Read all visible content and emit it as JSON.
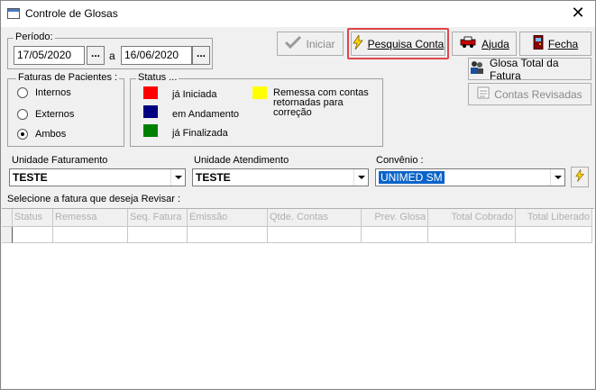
{
  "window": {
    "title": "Controle de Glosas",
    "close_glyph": "✕"
  },
  "periodo": {
    "label": "Período:",
    "start_date": "17/05/2020",
    "separator": "a",
    "end_date": "16/06/2020",
    "picker_label": "..."
  },
  "faturas": {
    "label": "Faturas de Pacientes :",
    "options": [
      "Internos",
      "Externos",
      "Ambos"
    ],
    "selected": "Ambos"
  },
  "status": {
    "label": "Status ...",
    "items": [
      {
        "label": "já Iniciada",
        "color": "#ff0000"
      },
      {
        "label": "em Andamento",
        "color": "#000080"
      },
      {
        "label": "já Finalizada",
        "color": "#008000"
      }
    ],
    "retornadas": {
      "label": "Remessa com contas retornadas para correção",
      "color": "#ffff00"
    }
  },
  "toolbar": {
    "iniciar": "Iniciar",
    "pesquisa": "Pesquisa Conta",
    "ajuda": "Ajuda",
    "fecha": "Fecha",
    "glosa_total": "Glosa Total da Fatura",
    "contas_revisadas": "Contas Revisadas"
  },
  "filters": {
    "unidade_faturamento": {
      "label": "Unidade Faturamento",
      "value": "TESTE"
    },
    "unidade_atendimento": {
      "label": "Unidade Atendimento",
      "value": "TESTE"
    },
    "convenio": {
      "label": "Convênio :",
      "value": "UNIMED SM"
    }
  },
  "grid": {
    "prompt": "Selecione a fatura que deseja Revisar :",
    "columns": [
      "Status",
      "Remessa",
      "Seq. Fatura",
      "Emissão",
      "Qtde. Contas",
      "Prev. Glosa",
      "Total Cobrado",
      "Total Liberado"
    ]
  },
  "icons": {
    "app": "window-icon",
    "iniciar": "checkmark-icon",
    "pesquisa": "lightning-icon",
    "ajuda": "help-car-icon",
    "fecha": "door-exit-icon",
    "glosa_total": "people-icon",
    "contas_revisadas": "document-list-icon",
    "convenio_search": "lightning-icon"
  }
}
